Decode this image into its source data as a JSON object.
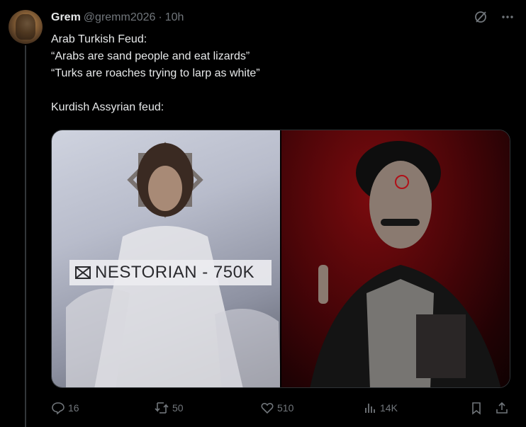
{
  "author": {
    "name": "Grem",
    "handle": "@gremm2026",
    "separator": "·",
    "time": "10h"
  },
  "tweet": {
    "lines": [
      "Arab Turkish Feud:",
      "“Arabs are sand people and eat lizards”",
      "“Turks are roaches trying to larp as white”",
      "",
      "Kurdish Assyrian feud:"
    ]
  },
  "media": {
    "left_banner_text": "NESTORIAN - 750K"
  },
  "actions": {
    "replies": "16",
    "reposts": "50",
    "likes": "510",
    "views": "14K"
  },
  "icons": {
    "top": [
      "grok-icon",
      "more-icon"
    ],
    "actions": [
      "reply-icon",
      "repost-icon",
      "like-icon",
      "views-icon",
      "bookmark-icon",
      "share-icon"
    ]
  },
  "colors": {
    "background": "#000000",
    "text": "#e7e9ea",
    "muted": "#71767b",
    "border": "#2f3336"
  }
}
